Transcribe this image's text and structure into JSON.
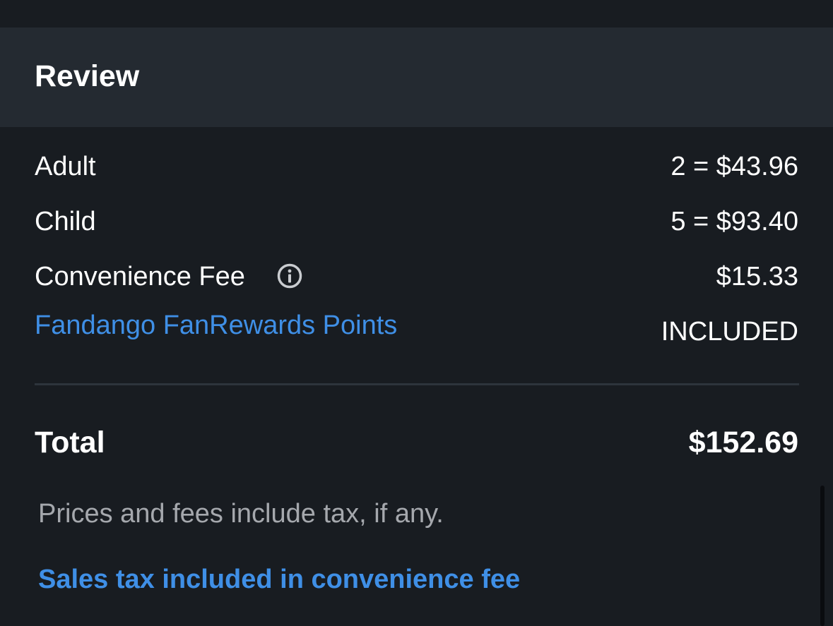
{
  "header": {
    "title": "Review"
  },
  "line_items": [
    {
      "label": "Adult",
      "value": "2 = $43.96"
    },
    {
      "label": "Child",
      "value": "5 = $93.40"
    },
    {
      "label": "Convenience Fee",
      "value": "$15.33",
      "icon": "info-icon"
    },
    {
      "label": "Fandango FanRewards Points",
      "value": "INCLUDED",
      "is_link": true
    }
  ],
  "total": {
    "label": "Total",
    "value": "$152.69"
  },
  "note": "Prices and fees include tax, if any.",
  "tax_link": "Sales tax included in convenience fee",
  "colors": {
    "background": "#181c21",
    "header_background": "#242a31",
    "link": "#3f8fe6",
    "muted_text": "#a5a8ad"
  }
}
